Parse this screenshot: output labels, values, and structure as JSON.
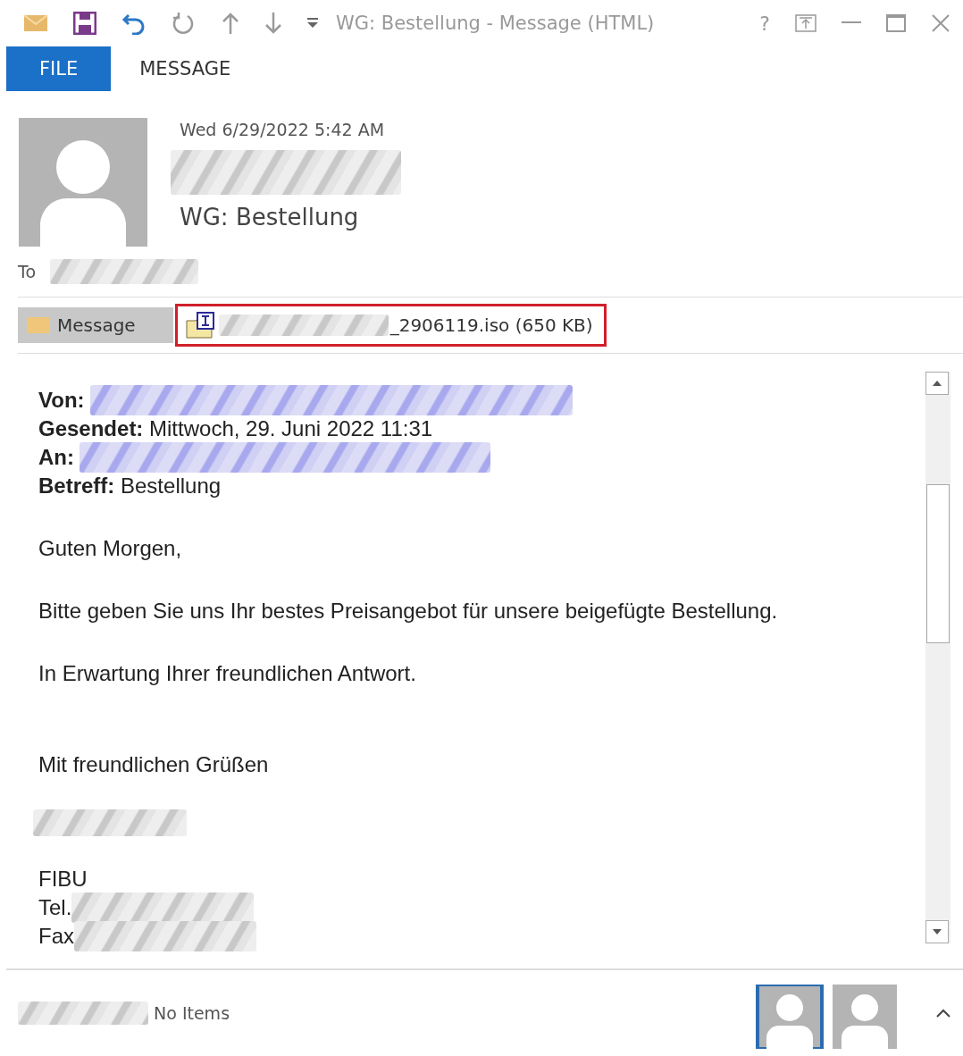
{
  "window": {
    "title": "WG: Bestellung - Message (HTML)",
    "controls": [
      "?"
    ]
  },
  "tabs": [
    {
      "label": "FILE",
      "selected": true
    },
    {
      "label": "MESSAGE",
      "selected": false
    }
  ],
  "header": {
    "date": "Wed 6/29/2022 5:42 AM",
    "subject": "WG: Bestellung",
    "to_label": "To"
  },
  "attachments": [
    {
      "kind": "message",
      "label": "Message",
      "selected": true
    },
    {
      "kind": "file",
      "label": "_2906119.iso (650 KB)",
      "selected": false,
      "highlighted": true
    }
  ],
  "body": {
    "fields": [
      {
        "label": "Von:",
        "redacted": true,
        "tinted": true
      },
      {
        "label": "Gesendet:",
        "value": "Mittwoch, 29. Juni 2022 11:31"
      },
      {
        "label": "An:",
        "redacted": true,
        "tinted": true
      },
      {
        "label": "Betreff:",
        "value": "Bestellung"
      }
    ],
    "paragraphs": [
      "Guten Morgen,",
      "Bitte geben Sie uns Ihr bestes Preisangebot für unsere beigefügte Bestellung.",
      "In Erwartung Ihrer freundlichen Antwort."
    ],
    "closing": "Mit freundlichen Grüßen",
    "signature": [
      {
        "text": "FIBU",
        "redacted": false
      },
      {
        "text": "Tel.",
        "redacted": true
      },
      {
        "text": "Fax",
        "redacted": true
      }
    ]
  },
  "people_pane": {
    "status": "No Items",
    "avatars": [
      {
        "selected": true
      },
      {
        "selected": false
      }
    ]
  }
}
